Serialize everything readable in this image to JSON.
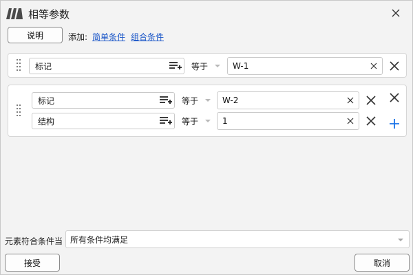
{
  "window": {
    "title": "相等参数"
  },
  "toolbar": {
    "explain_label": "说明",
    "add_label": "添加:",
    "simple_condition_link": "简单条件",
    "combined_condition_link": "组合条件"
  },
  "conditions": {
    "single": {
      "property": "标记",
      "operator": "等于",
      "value": "W-1"
    },
    "group": [
      {
        "property": "标记",
        "operator": "等于",
        "value": "W-2"
      },
      {
        "property": "结构",
        "operator": "等于",
        "value": "1"
      }
    ]
  },
  "footer": {
    "match_label": "元素符合条件当",
    "match_mode": "所有条件均满足",
    "accept_label": "接受",
    "cancel_label": "取消"
  },
  "colors": {
    "link": "#1a56c8",
    "plus": "#1a73e8",
    "logo": "#444444"
  },
  "icons": [
    "app-logo-icon",
    "close-icon",
    "drag-handle-icon",
    "property-list-add-icon",
    "clear-icon",
    "delete-icon",
    "add-icon",
    "dropdown-caret-icon"
  ]
}
